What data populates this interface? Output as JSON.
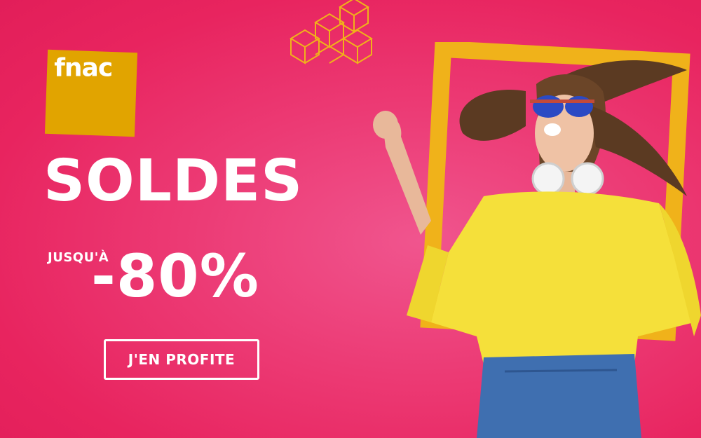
{
  "brand": {
    "name": "fnac",
    "color": "#e1a400"
  },
  "colors": {
    "background": "#e8245f",
    "frame": "#f0b21a",
    "shirt": "#f5e03a"
  },
  "promo": {
    "headline": "SOLDES",
    "prefix": "JUSQU'À",
    "discount": "-80%"
  },
  "cta": {
    "label": "J'EN PROFITE"
  },
  "decor": {
    "cubes_icon": "isometric-cubes-icon"
  }
}
